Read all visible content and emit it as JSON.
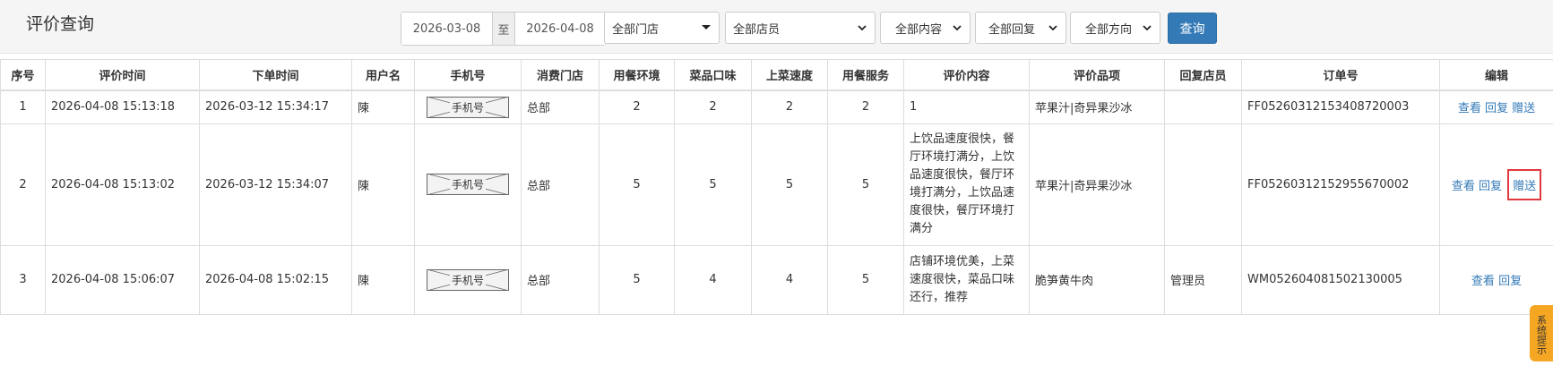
{
  "header": {
    "title": "评价查询"
  },
  "filters": {
    "start_date": "2026-03-08",
    "date_separator": "至",
    "end_date": "2026-04-08",
    "store": "全部门店",
    "staff": "全部店员",
    "content": "全部内容",
    "reply": "全部回复",
    "direction": "全部方向",
    "search_label": "查询"
  },
  "table": {
    "headers": [
      "序号",
      "评价时间",
      "下单时间",
      "用户名",
      "手机号",
      "消费门店",
      "用餐环境",
      "菜品口味",
      "上菜速度",
      "用餐服务",
      "评价内容",
      "评价品项",
      "回复店员",
      "订单号",
      "编辑"
    ],
    "phone_placeholder": "手机号",
    "rows": [
      {
        "index": "1",
        "review_time": "2026-04-08 15:13:18",
        "order_time": "2026-03-12 15:34:17",
        "username": "陳",
        "store": "总部",
        "env": "2",
        "taste": "2",
        "speed": "2",
        "service": "2",
        "content": "1",
        "items": "苹果汁|奇异果沙冰",
        "replier": "",
        "order_no": "FF05260312153408720003",
        "op_view": "查看",
        "op_reply": "回复",
        "op_gift": "赠送"
      },
      {
        "index": "2",
        "review_time": "2026-04-08 15:13:02",
        "order_time": "2026-03-12 15:34:07",
        "username": "陳",
        "store": "总部",
        "env": "5",
        "taste": "5",
        "speed": "5",
        "service": "5",
        "content": "上饮品速度很快，餐厅环境打满分，上饮品速度很快，餐厅环境打满分，上饮品速度很快，餐厅环境打满分",
        "items": "苹果汁|奇异果沙冰",
        "replier": "",
        "order_no": "FF05260312152955670002",
        "op_view": "查看",
        "op_reply": "回复",
        "op_gift": "赠送"
      },
      {
        "index": "3",
        "review_time": "2026-04-08 15:06:07",
        "order_time": "2026-04-08 15:02:15",
        "username": "陳",
        "store": "总部",
        "env": "5",
        "taste": "4",
        "speed": "4",
        "service": "5",
        "content": "店铺环境优美，上菜速度很快，菜品口味还行，推荐",
        "items": "脆笋黄牛肉",
        "replier": "管理员",
        "order_no": "WM052604081502130005",
        "op_view": "查看",
        "op_reply": "回复"
      }
    ]
  },
  "side_notice": {
    "label": "系统提示"
  },
  "colors": {
    "primary": "#337ab7",
    "highlight": "#e0383e",
    "notice": "#f5a623"
  }
}
